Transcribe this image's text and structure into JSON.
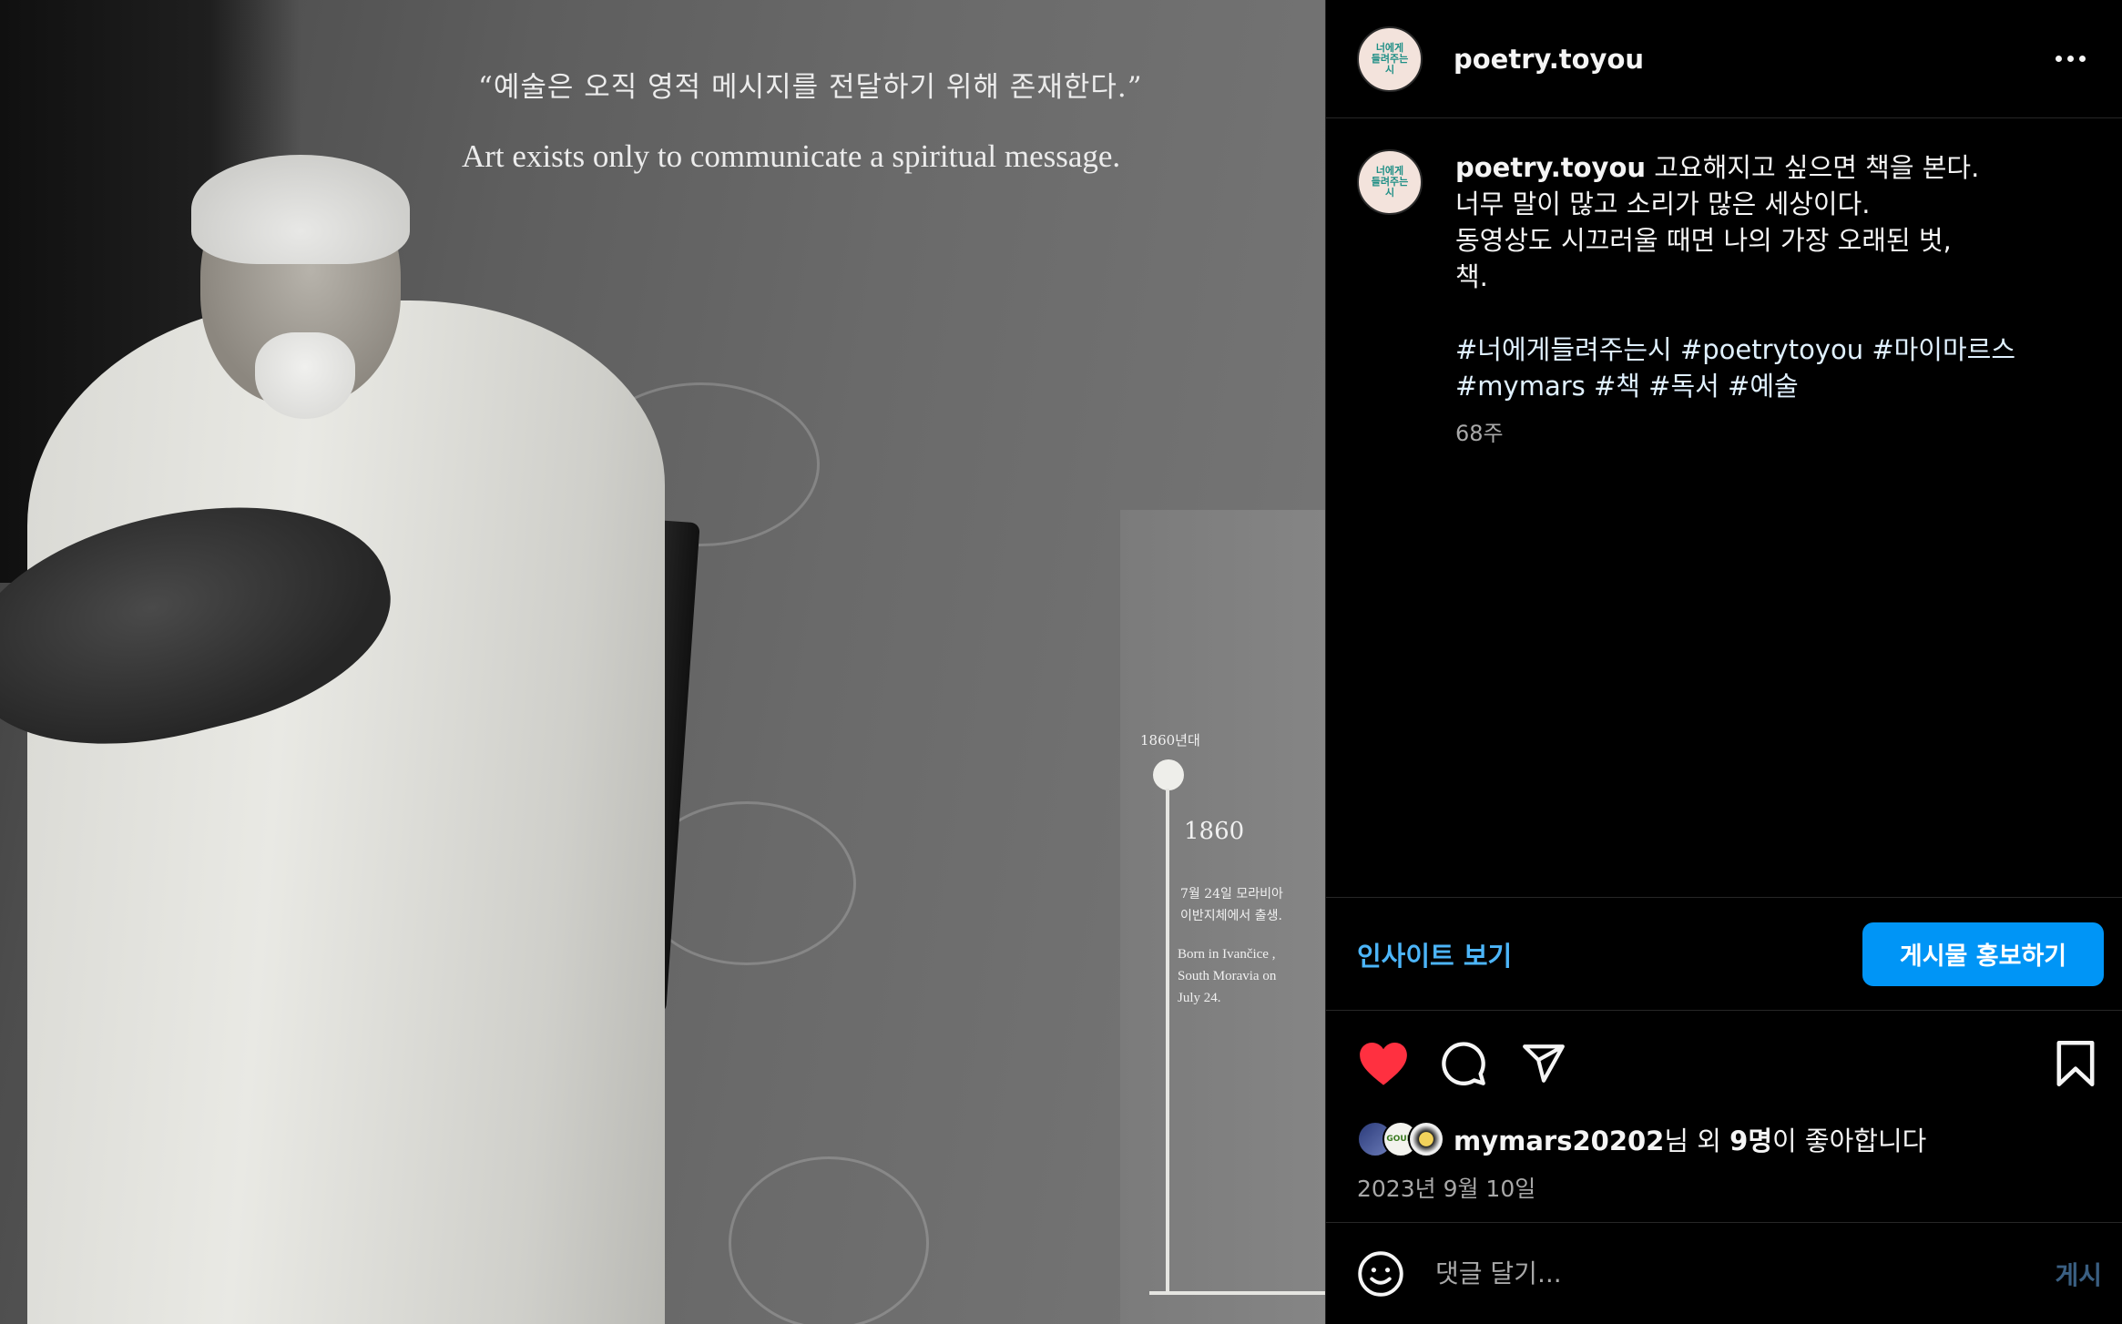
{
  "photo": {
    "quote_ko": "“예술은 오직 영적 메시지를 전달하기 위해 존재한다.”",
    "quote_en": "Art exists only to communicate a spiritual message.",
    "timeline": {
      "decade": "1860년대",
      "year": "1860",
      "ko_line1": "7월 24일 모라비아",
      "ko_line2": "이반지체에서 출생.",
      "en_line1": "Born in Ivančice ,",
      "en_line2": "South Moravia on",
      "en_line3": "July 24."
    }
  },
  "header": {
    "avatar_text": [
      "너에게",
      "들려주는",
      "시"
    ],
    "username": "poetry.toyou",
    "more_icon": "more-horizontal-icon"
  },
  "caption": {
    "username": "poetry.toyou",
    "lines": [
      "고요해지고 싶으면 책을 본다.",
      "너무 말이 많고 소리가 많은 세상이다.",
      "동영상도 시끄러울 때면 나의 가장 오래된 벗,",
      "책."
    ],
    "hashtags_line1": "#너에게들려주는시 #poetrytoyou #마이마르스",
    "hashtags_line2": "#mymars #책 #독서 #예술",
    "age": "68주"
  },
  "promo": {
    "insights_label": "인사이트 보기",
    "boost_label": "게시물 홍보하기"
  },
  "actions": {
    "like_icon": "heart-filled-icon",
    "comment_icon": "comment-icon",
    "share_icon": "send-icon",
    "save_icon": "bookmark-icon",
    "like_color": "#ff3040"
  },
  "likes": {
    "avatar2_text": "GOUM",
    "user": "mymars20202",
    "mid": "님 외 ",
    "count": "9명",
    "tail": "이 좋아합니다"
  },
  "date": "2023년 9월 10일",
  "comment": {
    "placeholder": "댓글 달기...",
    "post_label": "게시",
    "emoji_icon": "emoji-icon"
  }
}
